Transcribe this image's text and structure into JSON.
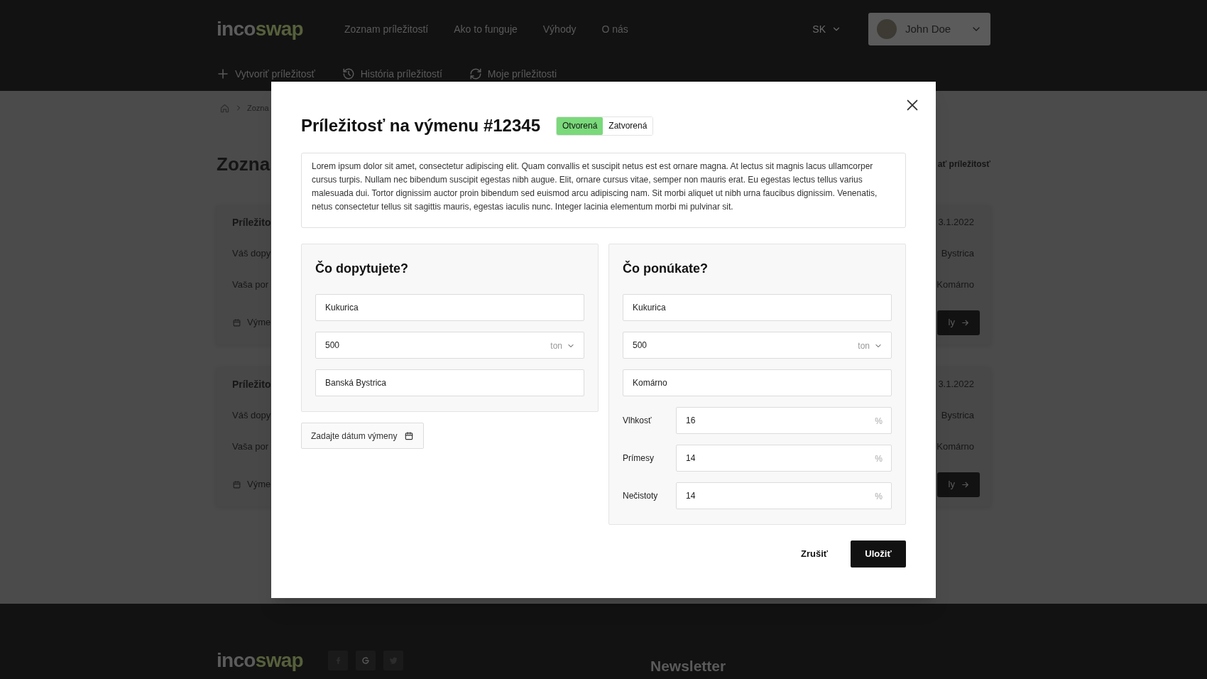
{
  "header": {
    "logo": {
      "part_1": "inco",
      "part_2": "swap"
    },
    "nav": [
      {
        "label": "Zoznam príležitostí"
      },
      {
        "label": "Ako to funguje"
      },
      {
        "label": "Výhody"
      },
      {
        "label": "O nás"
      }
    ],
    "language": "SK",
    "user": {
      "name": "John Doe"
    },
    "subnav": [
      {
        "kind": "plus",
        "label": "Vytvoriť príležitosť"
      },
      {
        "kind": "history",
        "label": "História príležitostí"
      },
      {
        "kind": "refresh",
        "label": "Moje príležitosti"
      }
    ]
  },
  "page": {
    "breadcrumb": "Zozna",
    "title": "Zozna",
    "action": "ať príležitosť",
    "cards": [
      {
        "title": "Príležito",
        "date": "3.1.2022",
        "rows": [
          {
            "label": "Váš dopy",
            "value": "Bystrica"
          },
          {
            "label": "Vaša por",
            "value": "Komárno"
          }
        ],
        "exchange_label": "Výme",
        "button": "ly"
      },
      {
        "title": "Príležito",
        "date": "3.1.2022",
        "rows": [
          {
            "label": "Váš dopy",
            "value": "Bystrica"
          },
          {
            "label": "Vaša por",
            "value": "Komárno"
          }
        ],
        "exchange_label": "Výme",
        "button": "ly"
      }
    ]
  },
  "modal": {
    "title": "Príležitosť na výmenu #12345",
    "status_options": [
      {
        "label": "Otvorená",
        "selected": true
      },
      {
        "label": "Zatvorená",
        "selected": false
      }
    ],
    "description": "Lorem ipsum dolor sit amet, consectetur adipiscing elit. Quam convallis et suscipit netus est est ornare magna. At lectus sit magnis lacus ullamcorper cursus turpis. Nullam nec bibendum suscipit egestas nibh augue. Elit, ornare cursus vitae, semper non mauris erat. Eu egestas lectus tellus varius malesuada dui. Tortor dignissim auctor proin bibendum sed euismod arcu adipiscing nam. Sit morbi aliquet ut nibh urna faucibus dignissim. Venenatis, netus consectetur tellus sit sagittis mauris, egestas iaculis nunc. Integer lacinia elementum morbi mi pulvinar sit.",
    "demand": {
      "heading": "Čo dopytujete?",
      "fields": [
        {
          "kind": "text",
          "value": "Kukurica"
        },
        {
          "kind": "quantity",
          "value": "500",
          "unit": "ton"
        },
        {
          "kind": "text",
          "value": "Banská Bystrica"
        }
      ]
    },
    "date_button": "Zadajte dátum výmeny",
    "offer": {
      "heading": "Čo ponúkate?",
      "fields": [
        {
          "kind": "text",
          "value": "Kukurica"
        },
        {
          "kind": "quantity",
          "value": "500",
          "unit": "ton"
        },
        {
          "kind": "text",
          "value": "Komárno"
        },
        {
          "kind": "percent",
          "label": "Vlhkosť",
          "value": "16",
          "unit": "%"
        },
        {
          "kind": "percent",
          "label": "Prímesy",
          "value": "14",
          "unit": "%"
        },
        {
          "kind": "percent",
          "label": "Nečistoty",
          "value": "14",
          "unit": "%"
        }
      ]
    },
    "cancel_button": "Zrušiť",
    "save_button": "Uložiť"
  },
  "footer": {
    "logo": {
      "part_1": "inco",
      "part_2": "swap"
    },
    "newsletter_heading": "Newsletter"
  }
}
